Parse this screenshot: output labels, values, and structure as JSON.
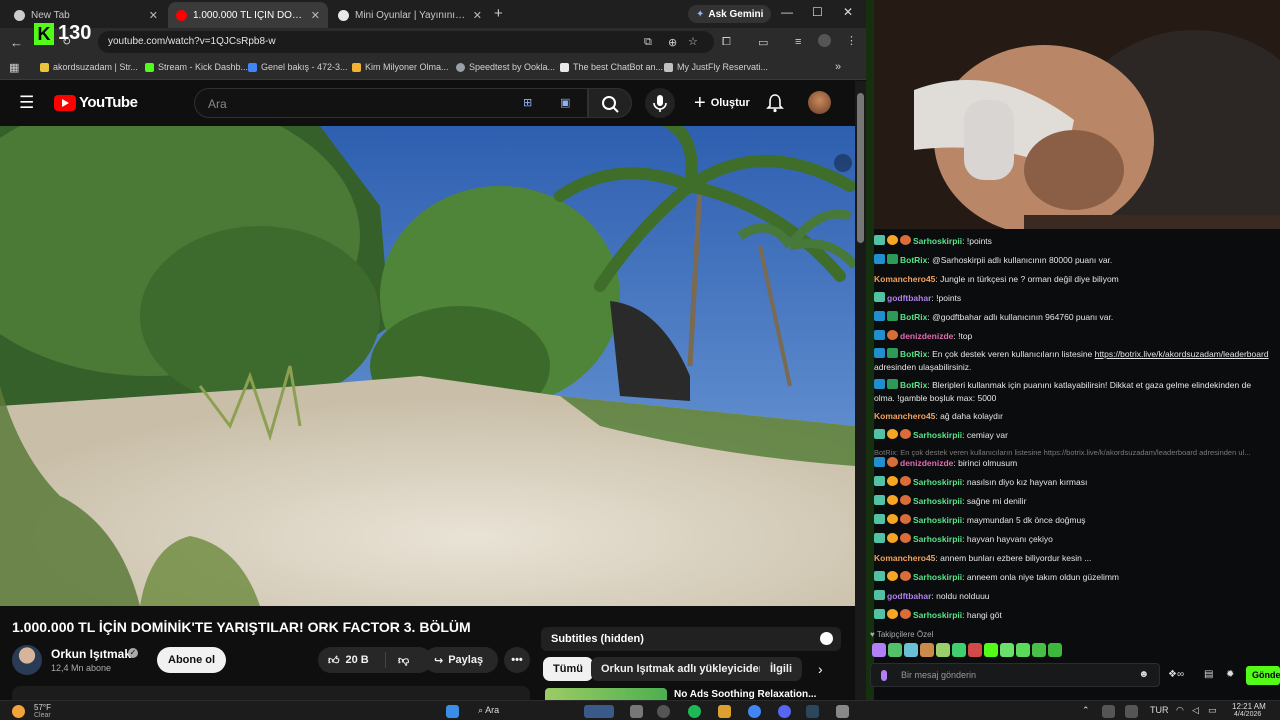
{
  "browser": {
    "tabs": [
      {
        "label": "New Tab",
        "active": false
      },
      {
        "label": "1.000.000 TL İÇİN DOMİNİK'TE",
        "active": true
      },
      {
        "label": "Mini Oyunlar | Yayınını güçlend",
        "active": false
      }
    ],
    "gemini_label": "Ask Gemini",
    "url": "youtube.com/watch?v=1QJCsRpb8-w",
    "bookmarks": [
      "akordsuzadam | Str...",
      "Stream - Kick Dashb...",
      "Genel bakış - 472-3...",
      "Kim Milyoner Olma...",
      "Speedtest by Ookla...",
      "The best ChatBot an...",
      "My JustFly Reservati..."
    ]
  },
  "overlay": {
    "viewer_count": "130"
  },
  "youtube": {
    "logo_text": "YouTube",
    "search_placeholder": "Ara",
    "create_label": "Oluştur",
    "video": {
      "title": "1.000.000 TL İÇİN DOMİNİK'TE YARIŞTILAR! ORK FACTOR 3. BÖLÜM",
      "channel": "Orkun Işıtmak",
      "subscribers": "12,4 Mn abone",
      "subscribe_label": "Abone ol",
      "likes": "20 B",
      "share_label": "Paylaş"
    },
    "subtitles_label": "Subtitles (hidden)",
    "chips": [
      "Tümü",
      "Orkun Işıtmak adlı yükleyiciden",
      "İlgili"
    ],
    "recommended_title": "No Ads Soothing Relaxation..."
  },
  "chat": {
    "messages": [
      {
        "user": "Sarhoskirpii",
        "text": "!points",
        "color": "green",
        "badges": [
          "mod",
          "sub",
          "gift"
        ]
      },
      {
        "user": "BotRix",
        "text": "@Sarhoskirpii adlı kullanıcının 80000 puanı var.",
        "color": "green",
        "badges": [
          "bot",
          "kick"
        ]
      },
      {
        "user": "Komanchero45",
        "text": "Jungle ın türkçesi ne ? orman değil diye biliyom",
        "color": "orange",
        "badges": []
      },
      {
        "user": "godftbahar",
        "text": "!points",
        "color": "purple",
        "badges": [
          "mod"
        ]
      },
      {
        "user": "BotRix",
        "text": "@godftbahar adlı kullanıcının 964760 puanı var.",
        "color": "green",
        "badges": [
          "bot",
          "kick"
        ]
      },
      {
        "user": "denizdenizde",
        "text": "!top",
        "color": "pink",
        "badges": [
          "bot",
          "gift"
        ]
      },
      {
        "user": "BotRix",
        "text": "En çok destek veren kullanıcıların listesine",
        "link": "https://botrix.live/k/akordsuzadam/leaderboard",
        "text2": "adresinden ulaşabilirsiniz.",
        "color": "green",
        "badges": [
          "bot",
          "kick"
        ]
      },
      {
        "user": "BotRix",
        "text": "Bleripleri kullanmak için puanını katlayabilirsin! Dikkat et gaza gelme elindekinden de olma. !gamble boşluk max: 5000",
        "color": "green",
        "badges": [
          "bot",
          "kick"
        ]
      },
      {
        "user": "Komanchero45",
        "text": "ağ daha kolaydır",
        "color": "orange",
        "badges": []
      },
      {
        "user": "Sarhoskirpii",
        "text": "cemiay var",
        "color": "green",
        "badges": [
          "mod",
          "sub",
          "gift"
        ]
      },
      {
        "user": "",
        "text": "BotRix: En çok destek veren kullanıcıların listesine https://botrix.live/k/akordsuzadam/leaderboard adresinden ul...",
        "color": "faded",
        "badges": []
      },
      {
        "user": "denizdenizde",
        "text": "birinci olmusum",
        "color": "pink",
        "badges": [
          "bot",
          "gift"
        ]
      },
      {
        "user": "Sarhoskirpii",
        "text": "nasılsın diyo kız hayvan kırması",
        "color": "green",
        "badges": [
          "mod",
          "sub",
          "gift"
        ]
      },
      {
        "user": "Sarhoskirpii",
        "text": "sağne mi denilir",
        "color": "green",
        "badges": [
          "mod",
          "sub",
          "gift"
        ]
      },
      {
        "user": "Sarhoskirpii",
        "text": "maymundan 5 dk önce doğmuş",
        "color": "green",
        "badges": [
          "mod",
          "sub",
          "gift"
        ]
      },
      {
        "user": "Sarhoskirpii",
        "text": "hayvan hayvanı çekiyo",
        "color": "green",
        "badges": [
          "mod",
          "sub",
          "gift"
        ]
      },
      {
        "user": "Komanchero45",
        "text": "annem bunları ezbere biliyordur kesin ...",
        "color": "orange",
        "badges": []
      },
      {
        "user": "Sarhoskirpii",
        "text": "anneem onla niye takım oldun güzelimm",
        "color": "green",
        "badges": [
          "mod",
          "sub",
          "gift"
        ]
      },
      {
        "user": "godftbahar",
        "text": "noldu nolduuu",
        "color": "purple",
        "badges": [
          "mod"
        ]
      },
      {
        "user": "Sarhoskirpii",
        "text": "hangi göt",
        "color": "green",
        "badges": [
          "mod",
          "sub",
          "gift"
        ]
      }
    ],
    "followers_only_label": "Takipçilere Özel",
    "input_placeholder": "Bir mesaj gönderin",
    "send_label": "Gönder"
  },
  "taskbar": {
    "weather_temp": "57°F",
    "weather_text": "Clear",
    "search_label": "Ara",
    "language": "TUR",
    "time": "12:21 AM",
    "date": "4/4/2026"
  },
  "colors": {
    "kick_green": "#53fc18",
    "youtube_red": "#ff0000"
  }
}
